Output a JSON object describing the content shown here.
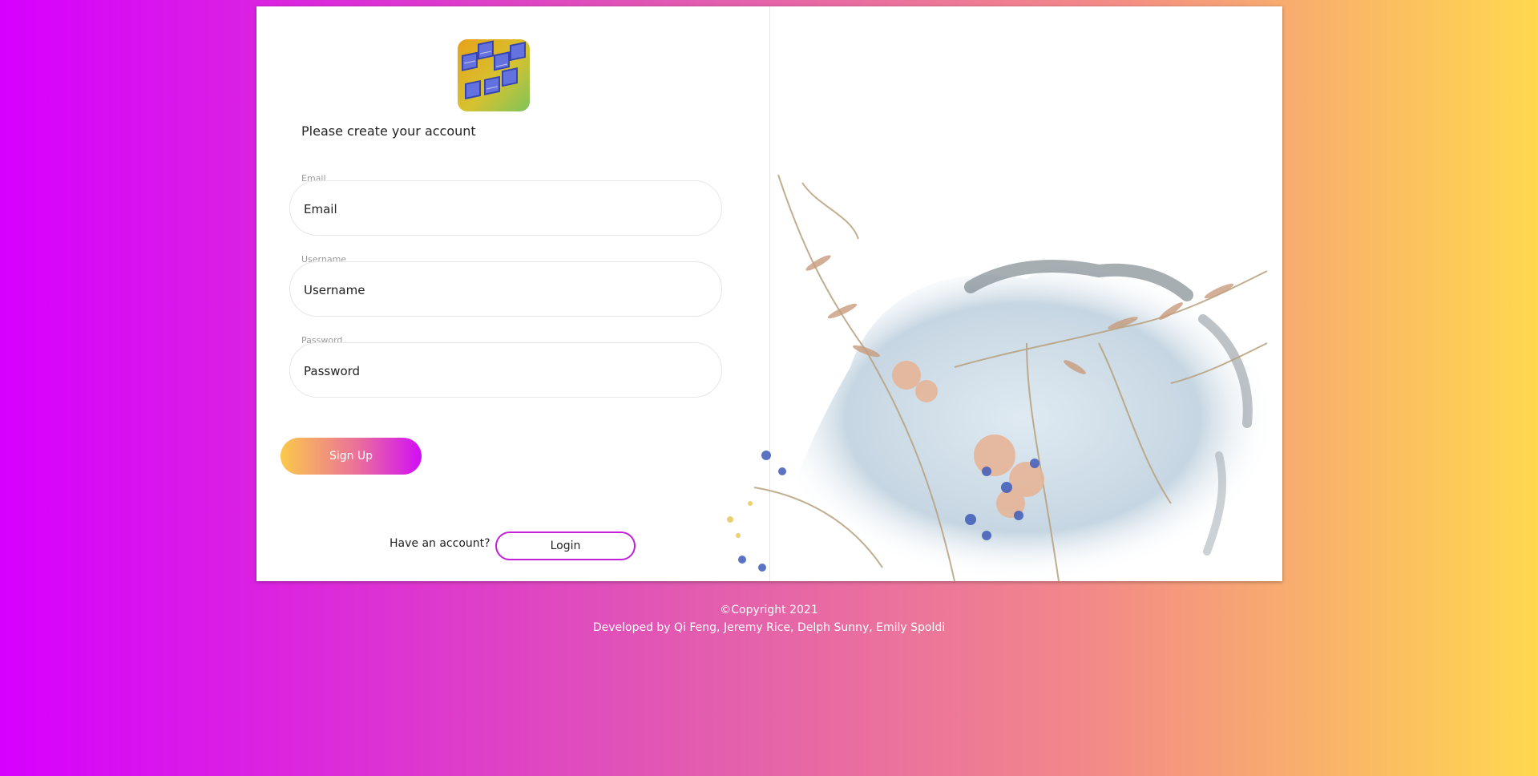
{
  "form": {
    "title": "Please create your account",
    "email_label": "Email",
    "email_placeholder": "Email",
    "username_label": "Username",
    "username_placeholder": "Username",
    "password_label": "Password",
    "password_placeholder": "Password",
    "signup_label": "Sign Up",
    "have_account_text": "Have an account?",
    "login_label": "Login"
  },
  "footer": {
    "copyright": "©Copyright 2021",
    "developers": "Developed by Qi Feng, Jeremy Rice, Delph Sunny, Emily Spoldi"
  },
  "colors": {
    "background_start": "#d600ff",
    "background_end": "#ffd84e",
    "login_border": "#c51fd7"
  },
  "icons": {
    "logo": "app-logo",
    "art": "pressed-flowers-watercolor"
  }
}
